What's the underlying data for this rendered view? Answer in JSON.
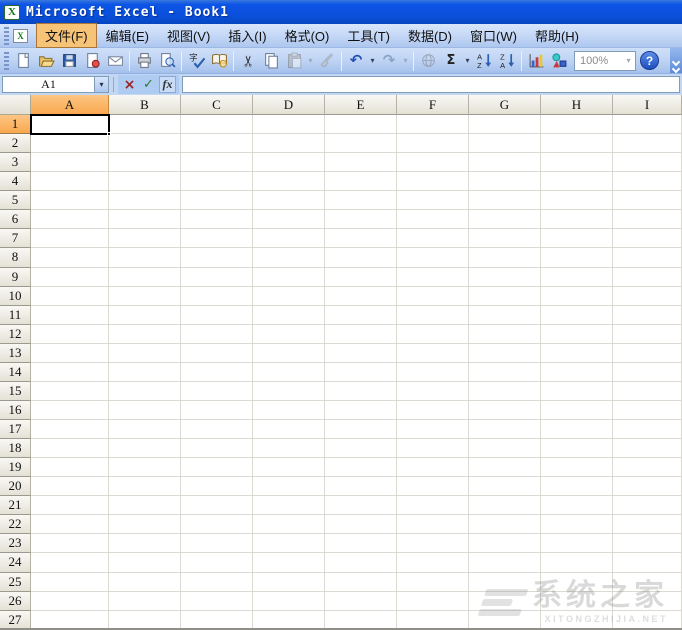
{
  "title_bar": {
    "title": "Microsoft Excel - Book1"
  },
  "menu_bar": {
    "items": [
      {
        "label": "文件(F)",
        "active": true
      },
      {
        "label": "编辑(E)",
        "active": false
      },
      {
        "label": "视图(V)",
        "active": false
      },
      {
        "label": "插入(I)",
        "active": false
      },
      {
        "label": "格式(O)",
        "active": false
      },
      {
        "label": "工具(T)",
        "active": false
      },
      {
        "label": "数据(D)",
        "active": false
      },
      {
        "label": "窗口(W)",
        "active": false
      },
      {
        "label": "帮助(H)",
        "active": false
      }
    ]
  },
  "toolbar": {
    "icon_names": [
      "new",
      "open",
      "save",
      "permission",
      "mail",
      "print",
      "print-preview",
      "spelling",
      "research",
      "cut",
      "copy",
      "paste",
      "format-painter",
      "undo",
      "redo",
      "hyperlink",
      "autosum",
      "sort-ascending",
      "sort-descending",
      "chart-wizard",
      "drawing",
      "zoom",
      "help",
      "toolbar-options"
    ],
    "disabled_buttons": [
      "paste",
      "format-painter",
      "redo",
      "hyperlink"
    ],
    "zoom_value": "100%",
    "glyphs": {
      "cut": "✂",
      "undo": "↶",
      "redo": "↷",
      "autosum": "Σ",
      "help": "?",
      "excel": "X",
      "spelling": "字",
      "letter_a": "A",
      "letter_z": "Z",
      "dropdown": "▾"
    }
  },
  "formula_bar": {
    "name_box": "A1",
    "cancel": "×",
    "enter": "✓",
    "function": "fx"
  },
  "spreadsheet": {
    "columns": [
      "A",
      "B",
      "C",
      "D",
      "E",
      "F",
      "G",
      "H",
      "I"
    ],
    "rows": [
      "1",
      "2",
      "3",
      "4",
      "5",
      "6",
      "7",
      "8",
      "9",
      "10",
      "11",
      "12",
      "13",
      "14",
      "15",
      "16",
      "17",
      "18",
      "19",
      "20",
      "21",
      "22",
      "23",
      "24",
      "25",
      "26",
      "27"
    ],
    "selected_column": "A",
    "selected_row": "1",
    "active_cell": "A1"
  },
  "watermark": {
    "title": "系统之家",
    "subtitle": "XITONGZHIJIA.NET"
  },
  "colors": {
    "titlebar_blue": "#0d55e6",
    "header_selected": "#fbb468",
    "menu_highlight": "#f7c377",
    "gridline": "#dadad2"
  }
}
